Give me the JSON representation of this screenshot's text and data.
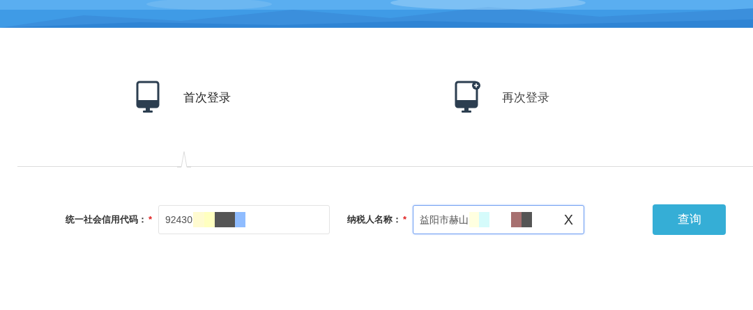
{
  "tabs": [
    {
      "label": "首次登录",
      "selected": true,
      "kind": "plain"
    },
    {
      "label": "再次登录",
      "selected": false,
      "kind": "plus"
    }
  ],
  "form": {
    "fields": [
      {
        "label": "统一社会信用代码：",
        "required_mark": "*",
        "value": "92430",
        "focused": false
      },
      {
        "label": "纳税人名称：",
        "required_mark": "*",
        "value": "益阳市赫山",
        "focused": true,
        "clear": "X"
      }
    ],
    "button": "查询"
  }
}
